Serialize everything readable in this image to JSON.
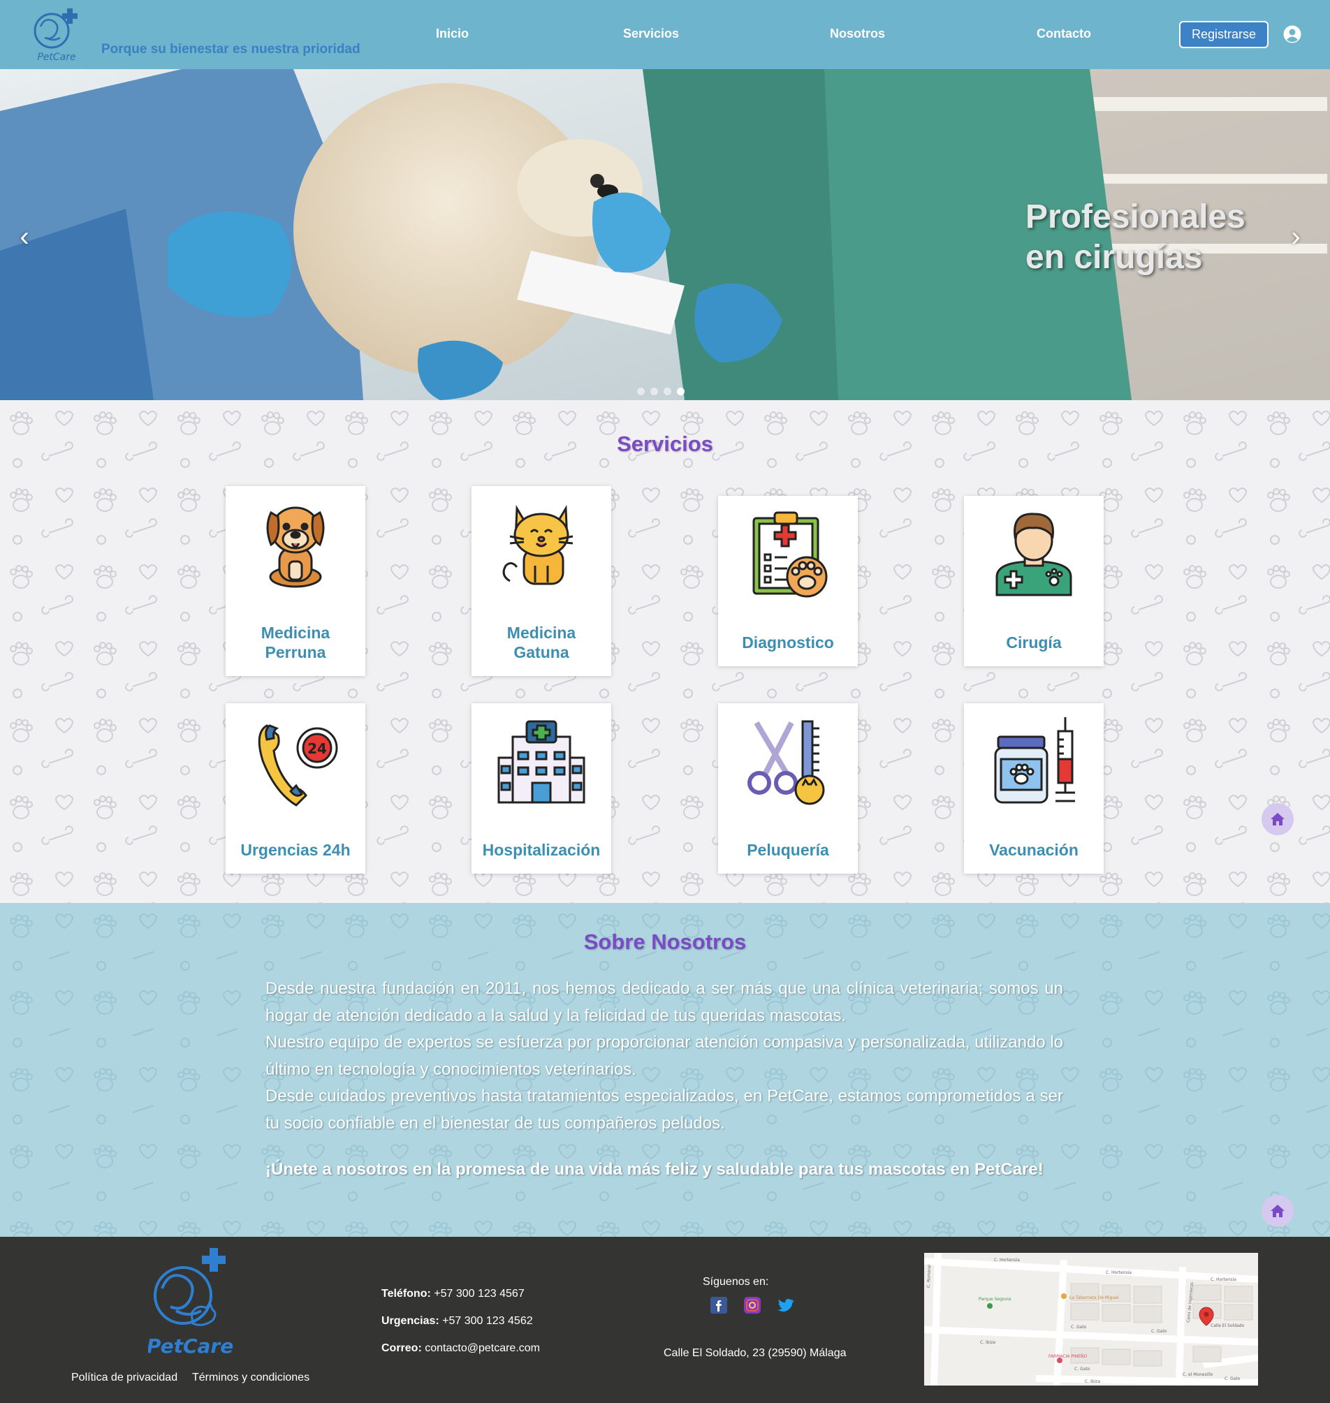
{
  "header": {
    "brand": "PetCare",
    "slogan": "Porque su bienestar es nuestra prioridad",
    "nav": [
      "Inicio",
      "Servicios",
      "Nosotros",
      "Contacto"
    ],
    "register_label": "Registrarse",
    "user_icon": "user-circle-icon"
  },
  "hero": {
    "caption_line1": "Profesionales",
    "caption_line2": "en cirugías",
    "prev_icon": "chevron-left-icon",
    "next_icon": "chevron-right-icon",
    "slide_count": 4,
    "active_slide": 4
  },
  "services": {
    "title": "Servicios",
    "items": [
      {
        "line1": "Medicina",
        "line2": "Perruna",
        "icon": "dog-icon"
      },
      {
        "line1": "Medicina",
        "line2": "Gatuna",
        "icon": "cat-icon"
      },
      {
        "line1": "Diagnostico",
        "line2": "",
        "icon": "clipboard-paw-icon"
      },
      {
        "line1": "Cirugía",
        "line2": "",
        "icon": "veterinarian-icon"
      },
      {
        "line1": "Urgencias 24h",
        "line2": "",
        "icon": "phone-24h-icon"
      },
      {
        "line1": "Hospitalización",
        "line2": "",
        "icon": "hospital-icon"
      },
      {
        "line1": "Peluquería",
        "line2": "",
        "icon": "grooming-scissors-icon"
      },
      {
        "line1": "Vacunación",
        "line2": "",
        "icon": "vaccine-icon"
      }
    ]
  },
  "about": {
    "title": "Sobre Nosotros",
    "p1": "Desde nuestra fundación en 2011, nos hemos dedicado a ser más que una clínica veterinaria; somos un hogar de atención dedicado a la salud y la felicidad de tus queridas mascotas.",
    "p2": "Nuestro equipo de expertos se esfuerza por proporcionar atención compasiva y personalizada, utilizando lo último en tecnología y conocimientos veterinarios.",
    "p3": "Desde cuidados preventivos hasta tratamientos especializados, en PetCare, estamos comprometidos a ser tu socio confiable en el bienestar de tus compañeros peludos.",
    "cta": "¡Únete a nosotros en la promesa de una vida más feliz y saludable para tus mascotas en PetCare!"
  },
  "footer": {
    "brand": "PetCare",
    "privacy": "Política de privacidad",
    "terms": "Términos y condiciones",
    "phone_label": "Teléfono:",
    "phone": "+57 300 123 4567",
    "urgent_label": "Urgencias:",
    "urgent": "+57 300 123 4562",
    "email_label": "Correo:",
    "email": "contacto@petcare.com",
    "follow": "Síguenos en:",
    "social": [
      "facebook-icon",
      "instagram-icon",
      "twitter-icon"
    ],
    "address": "Calle El Soldado, 23 (29590) Málaga",
    "map": {
      "streets": [
        "C. Hortensia",
        "C. Hortensia",
        "C. Hortensia",
        "C. Gato",
        "C. Gato",
        "C. Gato",
        "C. Gato",
        "C. Ibiza",
        "C. Ibiza",
        "C. el Monesillo",
        "Calle El Soldado",
        "C. Romeral",
        "Camí de Ingenieros"
      ],
      "places": [
        "Parque Segovia",
        "La Taberneta De Miguel",
        "FARMACIA PINEÑO"
      ]
    }
  },
  "colors": {
    "header_bg": "#6eb4cc",
    "accent_purple": "#7a4bc4",
    "service_label": "#3c8fb0",
    "about_bg": "#aed5e0",
    "footer_bg": "#343432",
    "button_blue": "#3d82c4"
  }
}
